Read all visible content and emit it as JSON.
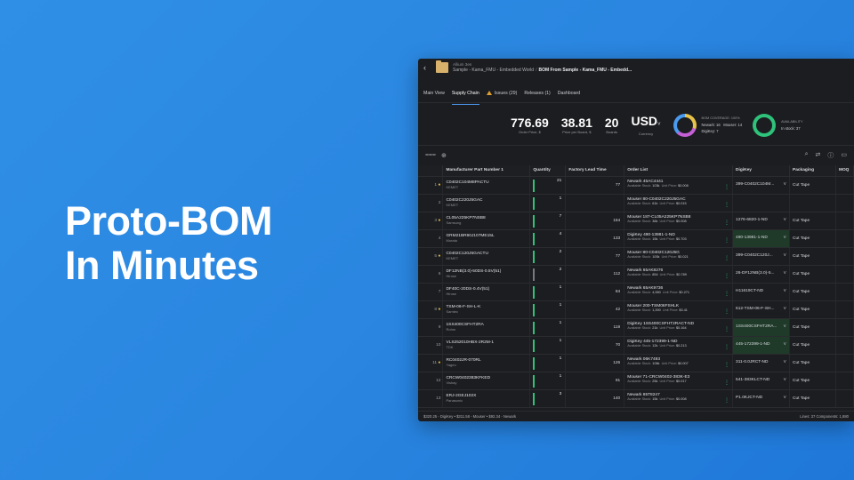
{
  "headline": {
    "line1": "Proto-BOM",
    "line2": "In Minutes"
  },
  "app": {
    "owner": "Allium 3es",
    "breadcrumb": [
      "Sample - Kama_FMU - Embedded World",
      "BOM From Sample - Kama_FMU - Embedd..."
    ],
    "tabs": [
      "Main View",
      "Supply Chain",
      "Issues (29)",
      "Releases (1)",
      "Dashboard"
    ],
    "stats": [
      {
        "value": "776.69",
        "label": "Order Price, $"
      },
      {
        "value": "38.81",
        "label": "Price per Board, $"
      },
      {
        "value": "20",
        "label": "Boards"
      },
      {
        "value": "USD",
        "label": "Currency"
      }
    ],
    "coverage": {
      "title": "BOM COVERAGE: 100%",
      "items": [
        "Newark: 16",
        "Mouser: 14",
        "DigiKey: 7"
      ]
    },
    "availability": {
      "title": "AVAILABILITY",
      "items": [
        "In stock: 37"
      ]
    },
    "columns": [
      "Manufacturer Part Number 1",
      "Quantity",
      "Factory Lead Time",
      "Order List",
      "DigiKey",
      "Packaging",
      "MOQ"
    ],
    "rows": [
      {
        "n": "1",
        "star": true,
        "mpn": "C0402C104M8PACTU",
        "mfr": "KEMET",
        "qty": "21",
        "lead": "77",
        "ol": "Newark 45AC4441",
        "stock": "103k",
        "price": "$0.008",
        "dk": "399-C0402C104M...",
        "dksel": false,
        "pack": "Cut Tape"
      },
      {
        "n": "2",
        "star": false,
        "mpn": "C0402C220J5GAC",
        "mfr": "KEMET",
        "qty": "1",
        "lead": "",
        "ol": "Mouser 80-C0402C220J5GAC",
        "stock": "61k",
        "price": "$0.015",
        "dk": "",
        "dksel": false,
        "pack": ""
      },
      {
        "n": "3",
        "star": true,
        "mpn": "CL05A225KP7NSB8",
        "mfr": "Samsung",
        "qty": "7",
        "lead": "154",
        "ol": "Mouser 187-CL05A225KP7NSB8",
        "stock": "36k",
        "price": "$0.008",
        "dk": "1276-6820-1-ND",
        "dksel": false,
        "pack": "Cut Tape"
      },
      {
        "n": "4",
        "star": false,
        "mpn": "GRM21BR60J107ME15L",
        "mfr": "Murata",
        "qty": "4",
        "lead": "133",
        "ol": "DigiKey 490-13981-1-ND",
        "stock": "15k",
        "price": "$0.703",
        "dk": "490-13981-1-ND",
        "dksel": true,
        "pack": "Cut Tape"
      },
      {
        "n": "5",
        "star": true,
        "mpn": "C0402C120J5GACTU",
        "mfr": "KEMET",
        "qty": "2",
        "lead": "77",
        "ol": "Mouser 80-C0402C120J5G",
        "stock": "100k",
        "price": "$0.021",
        "dk": "399-C0402C120J...",
        "dksel": false,
        "pack": "Cut Tape"
      },
      {
        "n": "6",
        "star": false,
        "mpn": "DF12NB(3.0)-50DS-0.5V(51)",
        "mfr": "Hirose",
        "qty": "2",
        "lead": "112",
        "ol": "Newark 65AK8276",
        "stock": "854",
        "price": "$0.789",
        "dk": "26-DF12NB(3.0)-5...",
        "dksel": false,
        "pack": "Cut Tape"
      },
      {
        "n": "7",
        "star": false,
        "mpn": "DF40C-20DS-0.4V(51)",
        "mfr": "Hirose",
        "qty": "1",
        "lead": "84",
        "ol": "Newark 65AK9736",
        "stock": "4,980",
        "price": "$0.271",
        "dk": "H11619CT-ND",
        "dksel": false,
        "pack": "Cut Tape"
      },
      {
        "n": "8",
        "star": true,
        "mpn": "TSM-06-F-SH-L-K",
        "mfr": "Samtec",
        "qty": "1",
        "lead": "42",
        "ol": "Mouser 200-TSM06FSHLK",
        "stock": "1,390",
        "price": "$3.41",
        "dk": "612-TSM-06-F-SH...",
        "dksel": false,
        "pack": "Cut Tape"
      },
      {
        "n": "9",
        "star": false,
        "mpn": "1SS400CSFHT2RA",
        "mfr": "Rohm",
        "qty": "1",
        "lead": "119",
        "ol": "DigiKey 1SS400CSFHT2RACT-ND",
        "stock": "21k",
        "price": "$0.164",
        "dk": "1SS400CSFHT2RA...",
        "dksel": true,
        "pack": "Cut Tape"
      },
      {
        "n": "10",
        "star": false,
        "mpn": "VLS252010HBX-2R2M-1",
        "mfr": "TDK",
        "qty": "1",
        "lead": "70",
        "ol": "DigiKey 445-172399-1-ND",
        "stock": "12k",
        "price": "$0.213",
        "dk": "445-172399-1-ND",
        "dksel": true,
        "pack": "Cut Tape"
      },
      {
        "n": "11",
        "star": true,
        "mpn": "RC0402JR-070RL",
        "mfr": "Yageo",
        "qty": "1",
        "lead": "126",
        "ol": "Newark 06K7493",
        "stock": "106k",
        "price": "$0.007",
        "dk": "311-0.0JRCT-ND",
        "dksel": false,
        "pack": "Cut Tape"
      },
      {
        "n": "12",
        "star": false,
        "mpn": "CRCW0402383KFKED",
        "mfr": "Vishay",
        "qty": "1",
        "lead": "91",
        "ol": "Mouser 71-CRCW0402-383K-E3",
        "stock": "25k",
        "price": "$0.017",
        "dk": "541-383KLCT-ND",
        "dksel": false,
        "pack": "Cut Tape"
      },
      {
        "n": "13",
        "star": false,
        "mpn": "ERJ-2GEJ102X",
        "mfr": "Panasonic",
        "qty": "3",
        "lead": "140",
        "ol": "Newark 85T8247",
        "stock": "15k",
        "price": "$0.008",
        "dk": "P1.0KJCT-ND",
        "dksel": false,
        "pack": "Cut Tape"
      }
    ],
    "footer": {
      "left": "$320.25 - DigiKey  •  $311.58 - Mouser  •  $92.34 - Newark",
      "right": "Lines: 37   Components: 1,880"
    },
    "labels": {
      "available": "Available Stock:",
      "unit": "Unit Price:"
    }
  }
}
